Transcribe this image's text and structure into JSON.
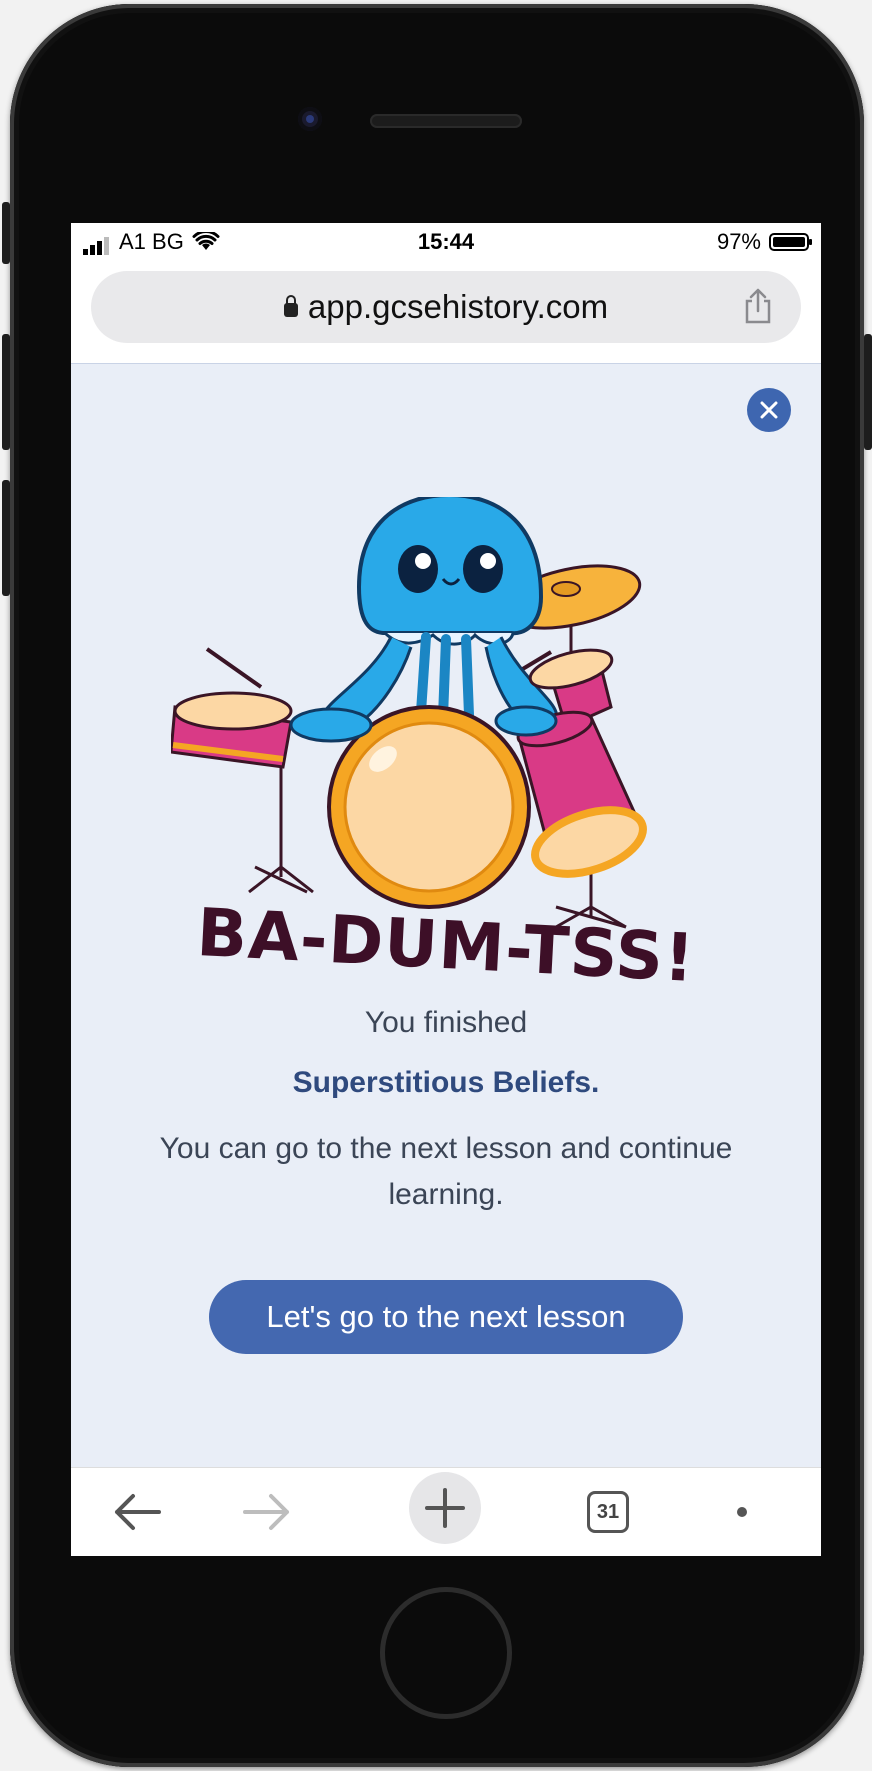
{
  "status_bar": {
    "carrier": "A1 BG",
    "time": "15:44",
    "battery": "97%"
  },
  "browser": {
    "url": "app.gcsehistory.com",
    "tabs_count": "31"
  },
  "illustration": {
    "caption": "BA-DUM-TSS!"
  },
  "message": {
    "line1": "You finished",
    "lesson_title": "Superstitious Beliefs.",
    "line3": "You can go to the next lesson and continue learning."
  },
  "cta": {
    "label": "Let's go to the next lesson"
  },
  "colors": {
    "accent": "#4468b0",
    "modal_bg": "#e9eef7",
    "jellyfish": "#29a9e8",
    "drum_pink": "#d93a86",
    "drum_orange": "#f5a623"
  },
  "icons": [
    "signal-icon",
    "wifi-icon",
    "battery-icon",
    "lock-icon",
    "share-icon",
    "close-icon",
    "back-arrow-icon",
    "forward-arrow-icon",
    "plus-icon",
    "tabs-icon",
    "more-icon"
  ]
}
